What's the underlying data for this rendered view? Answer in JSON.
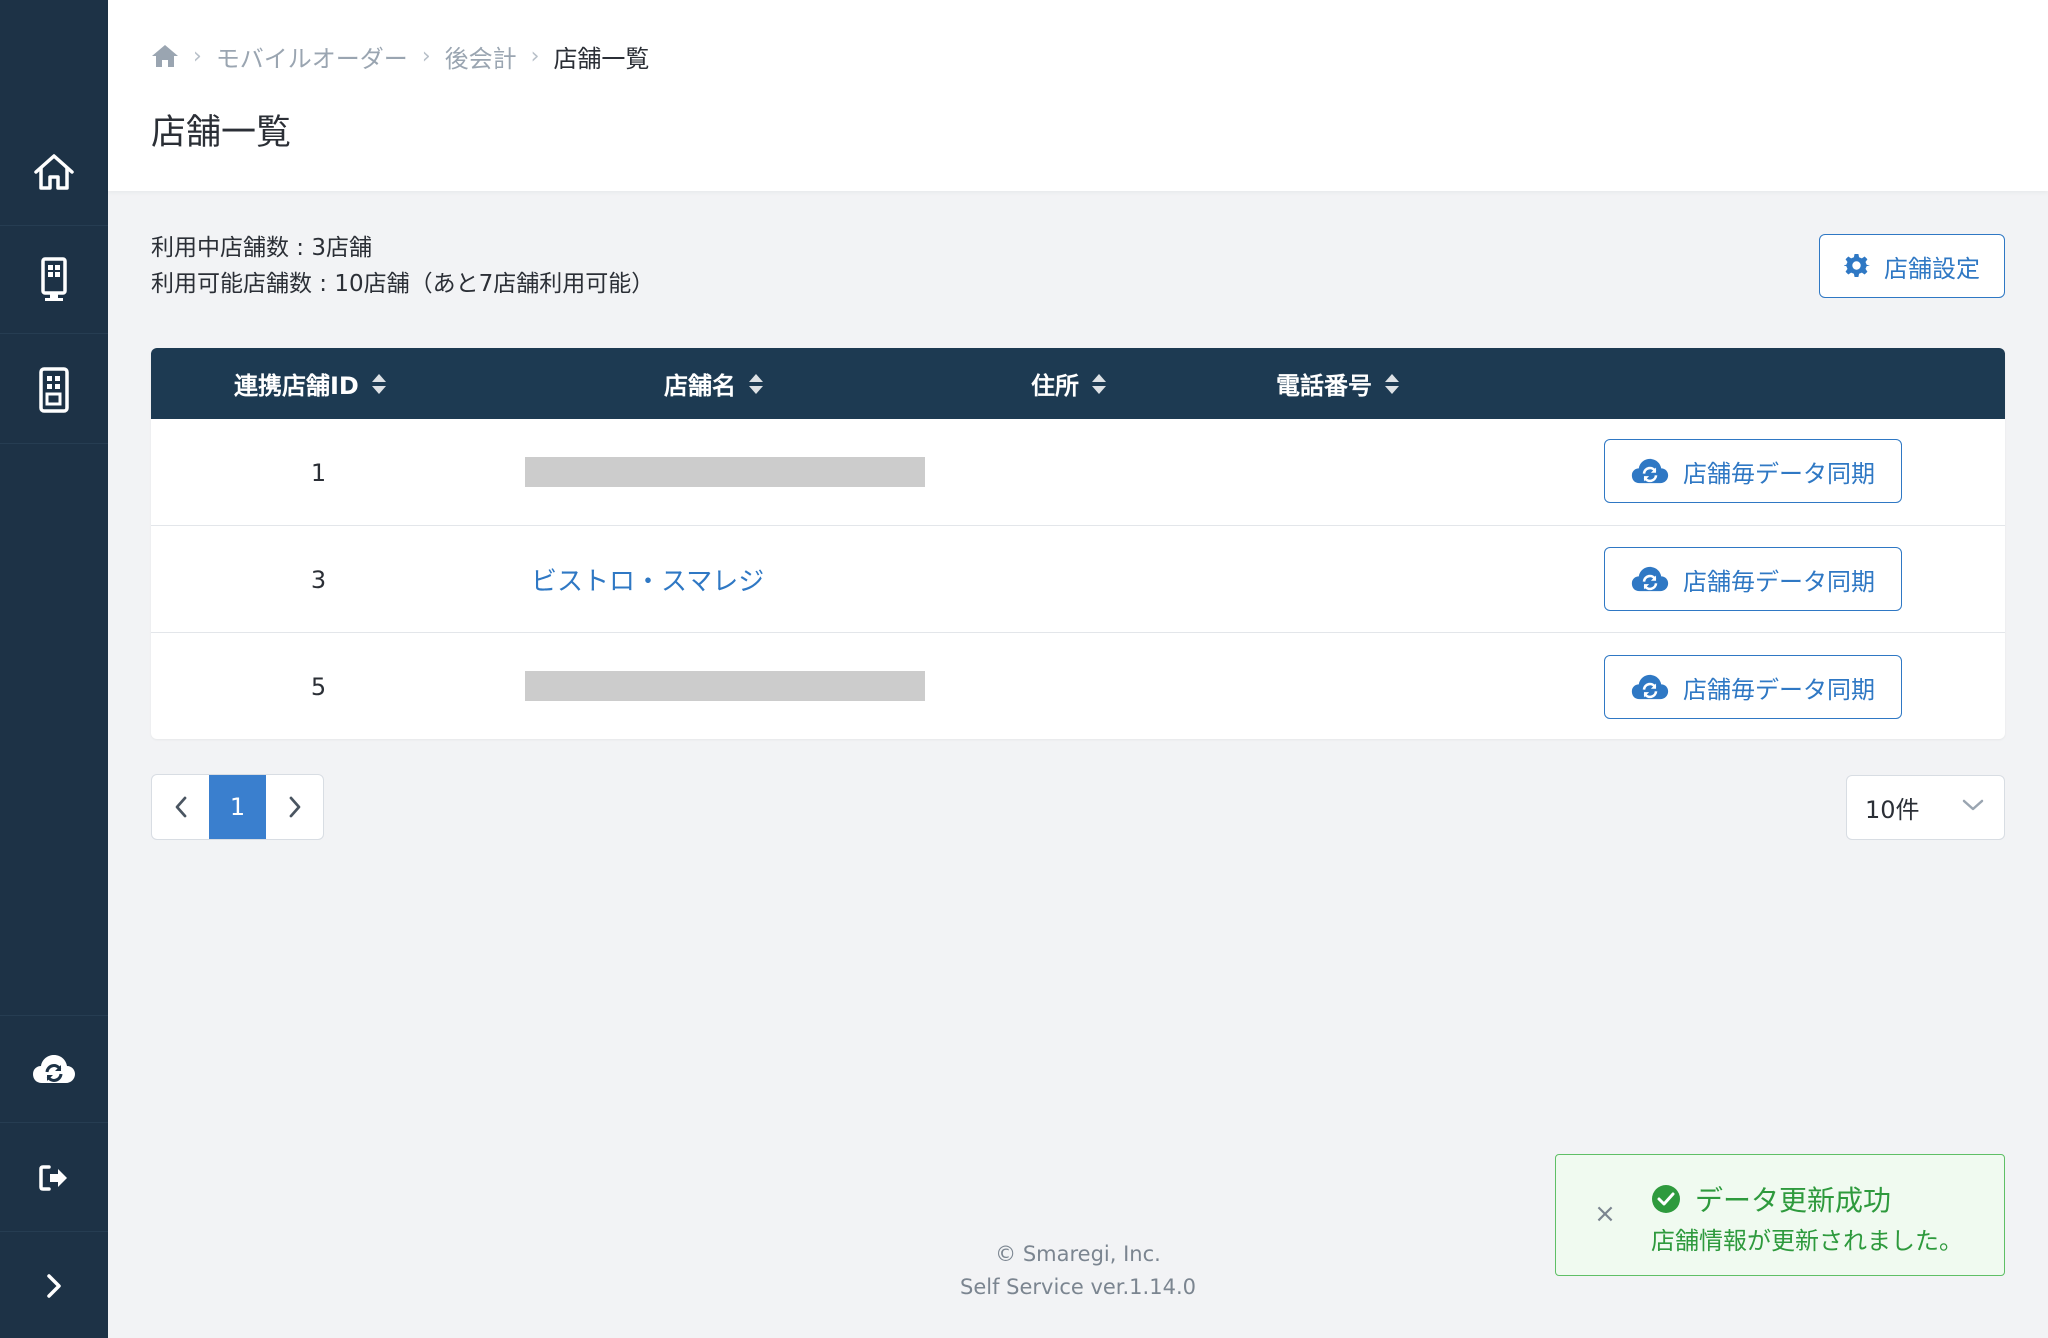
{
  "colors": {
    "sidebar": "#1d3246",
    "table_header": "#1d3a52",
    "accent": "#2f78c4",
    "success": "#2e9a3d"
  },
  "sidebar": {
    "items": [
      {
        "icon": "home-icon"
      },
      {
        "icon": "kiosk-icon"
      },
      {
        "icon": "tablet-icon"
      },
      {
        "icon": "cloud-sync-icon"
      },
      {
        "icon": "logout-icon"
      },
      {
        "icon": "chevron-right-icon"
      }
    ]
  },
  "breadcrumb": {
    "home_icon": "home-icon",
    "items": [
      "モバイルオーダー",
      "後会計",
      "店舗一覧"
    ]
  },
  "page": {
    "title": "店舗一覧"
  },
  "info": {
    "in_use": "利用中店舗数 : 3店舗",
    "available": "利用可能店舗数 : 10店舗（あと7店舗利用可能）"
  },
  "settings_button": {
    "label": "店舗設定",
    "icon": "gear-icon"
  },
  "table": {
    "columns": [
      "連携店舗ID",
      "店舗名",
      "住所",
      "電話番号"
    ],
    "rows": [
      {
        "id": "1",
        "name": "",
        "address": "",
        "phone": "",
        "action": "店舗毎データ同期"
      },
      {
        "id": "3",
        "name": "ビストロ・スマレジ",
        "address": "",
        "phone": "",
        "action": "店舗毎データ同期"
      },
      {
        "id": "5",
        "name": "",
        "address": "",
        "phone": "",
        "action": "店舗毎データ同期"
      }
    ]
  },
  "pagination": {
    "current": "1",
    "per_page": "10件"
  },
  "footer": {
    "copyright": "© Smaregi, Inc.",
    "version": "Self Service ver.1.14.0"
  },
  "toast": {
    "title": "データ更新成功",
    "message": "店舗情報が更新されました。",
    "close": "×"
  }
}
